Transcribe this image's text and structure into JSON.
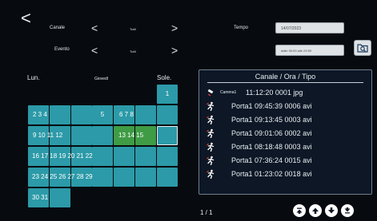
{
  "header": {
    "back_icon": "back-chevron-icon",
    "channel_label": "Canale",
    "channel_value": "Tutti",
    "event_label": "Evento",
    "event_value": "Tutti",
    "time_label": "Tempo",
    "date_value": "14/07/2023",
    "time_range_value": "dalle 00:00 alle 23:59",
    "search_icon": "search-folder-icon"
  },
  "calendar": {
    "head_left": "Lun.",
    "head_mid": "Giovedì",
    "head_right": "Sole.",
    "rows": [
      [
        "1"
      ],
      [
        "2 3 4",
        "5",
        "6 7 8"
      ],
      [
        "9 10 11 12",
        "13 14 15"
      ],
      [
        "16 17 18 19 20 21 22"
      ],
      [
        "23 24 25 26 27 28 29"
      ],
      [
        "30 31"
      ]
    ]
  },
  "list": {
    "title": "Canale / Ora / Tipo",
    "items": [
      {
        "type": "camera",
        "label": "Camma1",
        "text": "11:12:20 0001 jpg"
      },
      {
        "type": "door",
        "text": "Porta1 09:45:39 0006 avi"
      },
      {
        "type": "door",
        "text": "Porta1 09:13:45 0003 avi"
      },
      {
        "type": "door",
        "text": "Porta1 09:01:06 0002 avi"
      },
      {
        "type": "door",
        "text": "Porta1 08:18:48 0003 avi"
      },
      {
        "type": "door",
        "text": "Porta1 07:36:24 0015 avi"
      },
      {
        "type": "door",
        "text": "Porta1 01:23:02 0018 avi"
      }
    ]
  },
  "footer": {
    "page": "1 / 1",
    "buttons": [
      "first-page-icon",
      "prev-page-icon",
      "next-page-icon",
      "last-page-icon"
    ]
  },
  "colors": {
    "cell": "#2c9aa8",
    "active_cell": "#3f9c45",
    "background": "#070b10"
  }
}
